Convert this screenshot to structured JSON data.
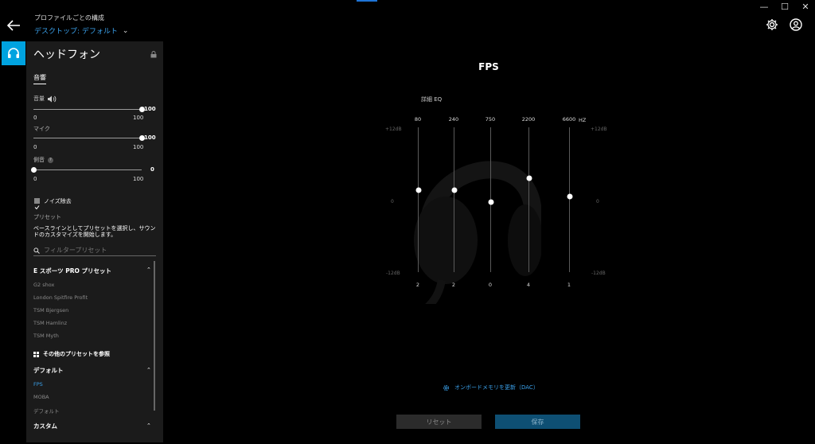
{
  "header": {
    "profile_caption": "プロファイルごとの構成",
    "profile_value": "デスクトップ: デフォルト"
  },
  "panel": {
    "title": "ヘッドフォン",
    "tab": "音響",
    "volume": {
      "label": "音量",
      "min": "0",
      "max": "100",
      "value": "100",
      "level": 1.0
    },
    "mic": {
      "label": "マイク",
      "min": "0",
      "max": "100",
      "value": "100",
      "level": 1.0
    },
    "sidetone": {
      "label": "側音",
      "min": "0",
      "max": "100",
      "value": "0",
      "level": 0.0
    },
    "noise_label": "ノイズ除去",
    "preset_heading": "プリセット",
    "preset_desc": "ベースラインとしてプリセットを選択し、サウンドのカスタマイズを開始します。",
    "filter_placeholder": "フィルタープリセット",
    "esports": {
      "heading": "E スポーツ PRO プリセット",
      "items": [
        "G2 shox",
        "London Spitfire Profit",
        "TSM Bjergsen",
        "TSM Hamlinz",
        "TSM Myth"
      ]
    },
    "browse_label": "その他のプリセットを参照",
    "default_group": {
      "heading": "デフォルト",
      "items": [
        "FPS",
        "MOBA",
        "デフォルト"
      ]
    },
    "custom_heading": "カスタム"
  },
  "main": {
    "title": "FPS",
    "eq_label": "詳細 EQ",
    "hz_label": "HZ",
    "db_top": "+12dB",
    "db_mid": "0",
    "db_bottom": "-12dB",
    "bands": [
      {
        "freq": "80",
        "gain": "2"
      },
      {
        "freq": "240",
        "gain": "2"
      },
      {
        "freq": "750",
        "gain": "0"
      },
      {
        "freq": "2200",
        "gain": "4"
      },
      {
        "freq": "6600",
        "gain": "1"
      }
    ],
    "dac_label": "オンボードメモリを更新（DAC）",
    "reset_label": "リセット",
    "save_label": "保存"
  },
  "colors": {
    "accent": "#3aa0ea",
    "tab_accent": "#00a3e0"
  }
}
